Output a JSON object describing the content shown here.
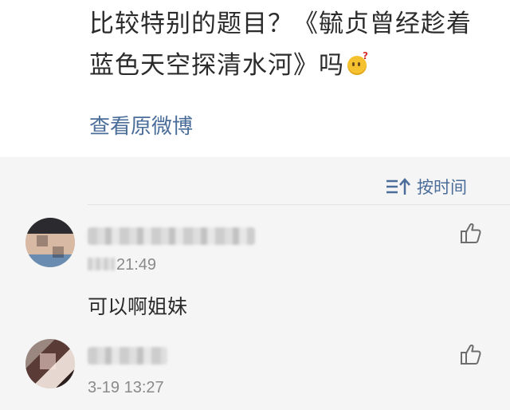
{
  "post": {
    "line1": "比较特别的题目？《毓贞曾经趁着",
    "line2": "蓝色天空探清水河》吗",
    "emoji": "thinking-face-emoji",
    "view_original_label": "查看原微博"
  },
  "comments_section": {
    "sort_label": "按时间",
    "sort_icon": "sort-icon",
    "like_icon": "thumbs-up-icon",
    "items": [
      {
        "time": "21:49",
        "time_prefix_blurred": "3-19",
        "text": "可以啊姐妹"
      },
      {
        "time": "3-19 13:27",
        "text": ""
      }
    ]
  },
  "colors": {
    "link": "#4a6d99",
    "text": "#2b2b2b",
    "meta": "#8a8a8a",
    "background": "#f5f5f5"
  }
}
